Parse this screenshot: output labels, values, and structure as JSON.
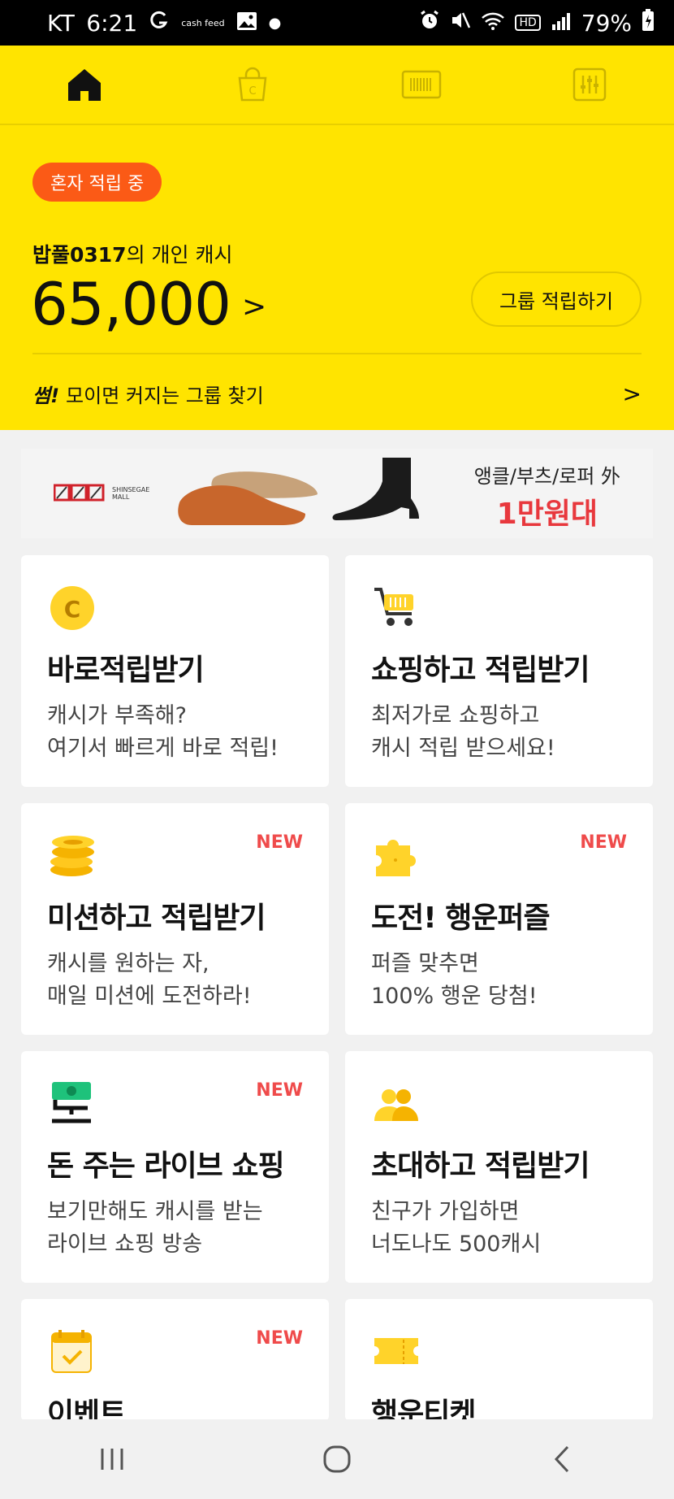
{
  "status_bar": {
    "carrier": "KT",
    "time": "6:21",
    "notif_text": "cash feed",
    "battery": "79%",
    "network_badge": "HD"
  },
  "top_nav": {
    "tabs": [
      {
        "name": "home-icon",
        "active": true
      },
      {
        "name": "shopping-bag-icon",
        "active": false
      },
      {
        "name": "barcode-icon",
        "active": false
      },
      {
        "name": "settings-sliders-icon",
        "active": false
      }
    ]
  },
  "hero": {
    "badge": "혼자 적립 중",
    "owner_name": "밥풀0317",
    "owner_suffix": "의 개인 캐시",
    "amount": "65,000",
    "amount_arrow": ">",
    "group_button": "그룹 적립하기",
    "find_brand": "썸!",
    "find_text": "모이면 커지는 그룹 찾기",
    "find_chevron": ">"
  },
  "banner": {
    "logo_line1": "SHINSEGAE",
    "logo_line2": "MALL",
    "copy_line1": "앵클/부츠/로퍼 外",
    "copy_line2": "1만원대"
  },
  "cards": [
    {
      "title": "바로적립받기",
      "desc": [
        "캐시가 부족해?",
        "여기서 빠르게 바로 적립!"
      ],
      "new": "",
      "icon": "coin-c-icon"
    },
    {
      "title": "쇼핑하고 적립받기",
      "desc": [
        "최저가로 쇼핑하고",
        "캐시 적립 받으세요!"
      ],
      "new": "",
      "icon": "shopping-cart-icon"
    },
    {
      "title": "미션하고 적립받기",
      "desc": [
        "캐시를 원하는 자,",
        "매일 미션에 도전하라!"
      ],
      "new": "NEW",
      "icon": "coin-stack-icon"
    },
    {
      "title": "도전! 행운퍼즐",
      "desc": [
        "퍼즐 맞추면",
        "100% 행운 당첨!"
      ],
      "new": "NEW",
      "icon": "puzzle-piece-icon"
    },
    {
      "title": "돈 주는 라이브 쇼핑",
      "desc": [
        "보기만해도 캐시를 받는",
        "라이브 쇼핑 방송"
      ],
      "new": "NEW",
      "icon": "money-live-icon"
    },
    {
      "title": "초대하고 적립받기",
      "desc": [
        "친구가 가입하면",
        "너도나도 500캐시"
      ],
      "new": "",
      "icon": "friends-icon"
    },
    {
      "title": "이벤트",
      "desc": [],
      "new": "NEW",
      "icon": "calendar-check-icon"
    },
    {
      "title": "행운티켓",
      "desc": [],
      "new": "",
      "icon": "ticket-icon"
    }
  ],
  "colors": {
    "brand_yellow": "#ffe400",
    "badge_orange": "#fb5a16",
    "new_red": "#ef4b4b",
    "banner_red": "#e8383d"
  }
}
